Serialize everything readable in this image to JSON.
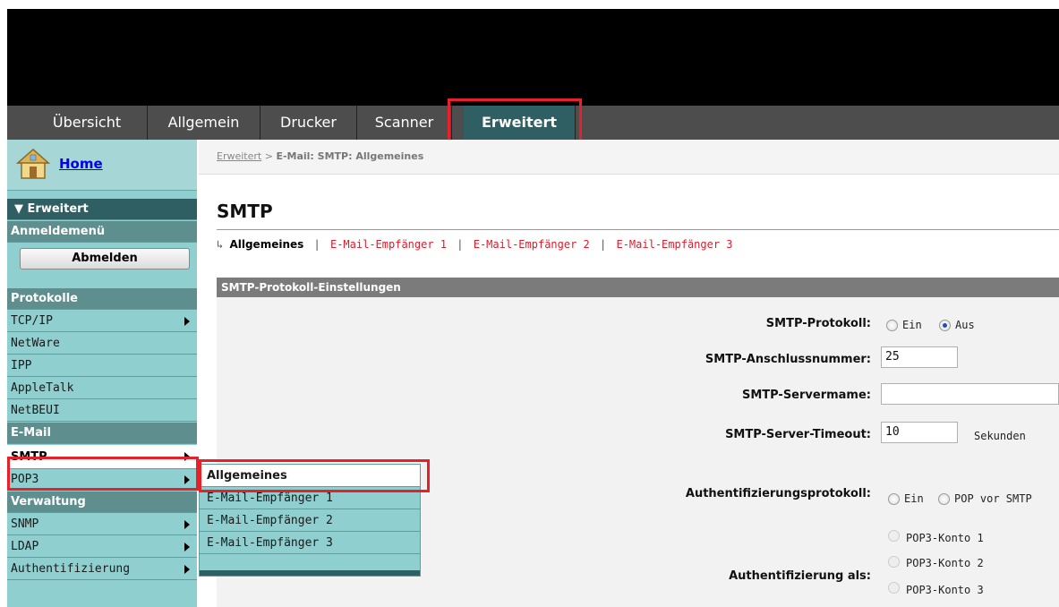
{
  "tabs": [
    "Übersicht",
    "Allgemein",
    "Drucker",
    "Scanner",
    "Erweitert"
  ],
  "active_tab": "Erweitert",
  "nav": {
    "home": "Home",
    "section_erweitert": "Erweitert",
    "anmeldemenu": "Anmeldemenü",
    "abmelden": "Abmelden",
    "protokolle": "Protokolle",
    "tcpip": "TCP/IP",
    "netware": "NetWare",
    "ipp": "IPP",
    "appletalk": "AppleTalk",
    "netbeui": "NetBEUI",
    "email": "E-Mail",
    "smtp": "SMTP",
    "pop3": "POP3",
    "verwaltung": "Verwaltung",
    "snmp": "SNMP",
    "ldap": "LDAP",
    "authentifizierung": "Authentifizierung"
  },
  "flyout": [
    "Allgemeines",
    "E-Mail-Empfänger 1",
    "E-Mail-Empfänger 2",
    "E-Mail-Empfänger 3"
  ],
  "breadcrumb": {
    "link": "Erweitert",
    "rest": "E-Mail: SMTP: Allgemeines"
  },
  "page_title": "SMTP",
  "subnav": {
    "current": "Allgemeines",
    "links": [
      "E-Mail-Empfänger 1",
      "E-Mail-Empfänger 2",
      "E-Mail-Empfänger 3"
    ]
  },
  "section_title": "SMTP-Protokoll-Einstellungen",
  "form": {
    "protokoll_label": "SMTP-Protokoll:",
    "ein": "Ein",
    "aus": "Aus",
    "protokoll_value": "Aus",
    "port_label": "SMTP-Anschlussnummer:",
    "port_value": "25",
    "server_label": "SMTP-Servermame:",
    "server_value": "",
    "timeout_label": "SMTP-Server-Timeout:",
    "timeout_value": "10",
    "timeout_unit": "Sekunden",
    "auth_proto_label": "Authentifizierungsprotokoll:",
    "auth_ein": "Ein",
    "auth_pop": "POP vor SMTP",
    "auth_as_label": "Authentifizierung als:",
    "pop3_accounts": [
      "POP3-Konto 1",
      "POP3-Konto 2",
      "POP3-Konto 3"
    ]
  }
}
